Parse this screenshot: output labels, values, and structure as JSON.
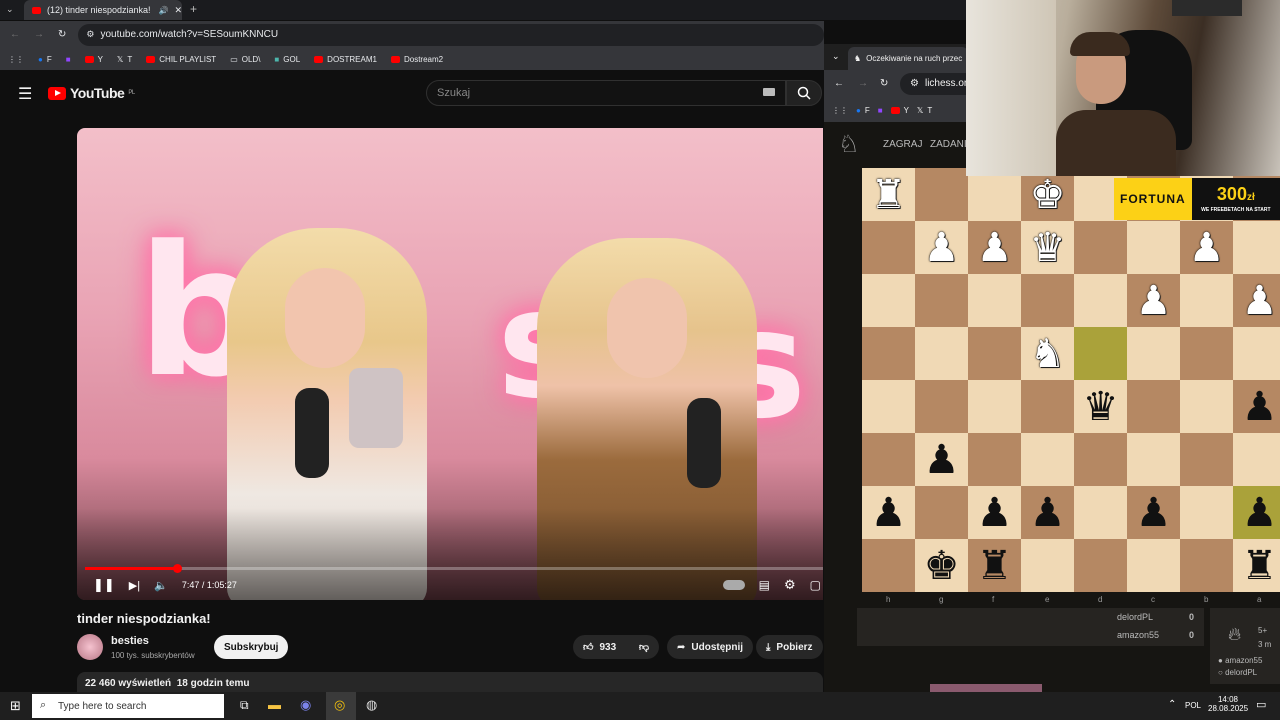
{
  "left_browser": {
    "tab_title": "(12) tinder niespodzianka! -",
    "url": "youtube.com/watch?v=SESoumKNNCU",
    "bookmarks": [
      "F",
      "Y",
      "T",
      "CHIL PLAYLIST",
      "OLD\\",
      "GOL",
      "DOSTREAM1",
      "Dostream2"
    ]
  },
  "youtube": {
    "logo_text": "YouTube",
    "region": "PL",
    "search_placeholder": "Szukaj",
    "time_current": "7:47",
    "time_total": "1:05:27",
    "progress_fraction": 0.124,
    "video_title": "tinder niespodzianka!",
    "channel_name": "besties",
    "subscribers": "100 tys. subskrybentów",
    "subscribe_label": "Subskrybuj",
    "likes": "933",
    "share_label": "Udostępnij",
    "download_label": "Pobierz",
    "views": "22 460 wyświetleń",
    "posted": "18 godzin temu"
  },
  "right_browser": {
    "tab_title": "Oczekiwanie na ruch przec",
    "url": "lichess.or",
    "bookmarks": [
      "F",
      "Y",
      "T"
    ],
    "nav": [
      "ZAGRAJ",
      "ZADANI"
    ]
  },
  "chess": {
    "files": [
      "h",
      "g",
      "f",
      "e",
      "d",
      "c",
      "b",
      "a"
    ],
    "rows": [
      [
        "wR",
        "",
        "",
        "wK",
        "",
        "",
        "",
        ""
      ],
      [
        "",
        "wP",
        "wP",
        "wQ",
        "",
        "",
        "wP",
        ""
      ],
      [
        "",
        "",
        "",
        "",
        "",
        "wP",
        "",
        "wP"
      ],
      [
        "",
        "",
        "",
        "wN",
        "hl",
        "",
        "",
        ""
      ],
      [
        "",
        "",
        "",
        "",
        "bQ",
        "",
        "",
        "bP"
      ],
      [
        "",
        "bP",
        "",
        "",
        "",
        "",
        "",
        ""
      ],
      [
        "bP",
        "",
        "bP",
        "bP",
        "",
        "bP",
        "",
        "bPhl"
      ],
      [
        "",
        "bK",
        "bR",
        "",
        "",
        "",
        "",
        "bR"
      ]
    ],
    "players": [
      {
        "name": "delordPL",
        "score": "0"
      },
      {
        "name": "amazon55",
        "score": "0"
      }
    ],
    "side_list": [
      "amazon55",
      "delordPL"
    ],
    "side_time": "5+",
    "side_sub": "3 m"
  },
  "ad": {
    "brand": "FORTUNA",
    "amount": "300",
    "currency": "zł",
    "tagline": "WE FREEBETACH NA START"
  },
  "taskbar": {
    "search_placeholder": "Type here to search",
    "language": "POL",
    "time": "14:08",
    "date": "28.08.2025"
  }
}
